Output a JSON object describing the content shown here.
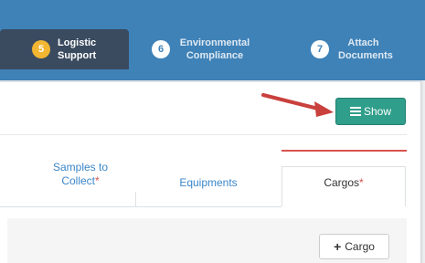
{
  "steps": [
    {
      "number": "5",
      "label_line1": "Logistic",
      "label_line2": "Support",
      "active": true
    },
    {
      "number": "6",
      "label_line1": "Environmental",
      "label_line2": "Compliance",
      "active": false
    },
    {
      "number": "7",
      "label_line1": "Attach",
      "label_line2": "Documents",
      "active": false
    }
  ],
  "toolbar": {
    "show_label": "Show"
  },
  "tabs": {
    "samples_line1": "Samples to",
    "samples_line2": "Collect",
    "equipments": "Equipments",
    "cargos": "Cargos",
    "required_mark": "*"
  },
  "content": {
    "add_cargo_label": "Cargo"
  },
  "colors": {
    "header": "#3e82b8",
    "active_step": "#3a4a5f",
    "step_badge_active": "#f2b632",
    "show_button": "#2f9e8a",
    "accent_red": "#d9534f",
    "tab_link": "#3a86c8"
  },
  "icons": {
    "show": "list-icon",
    "add": "plus-icon",
    "annotation": "arrow-annotation"
  }
}
